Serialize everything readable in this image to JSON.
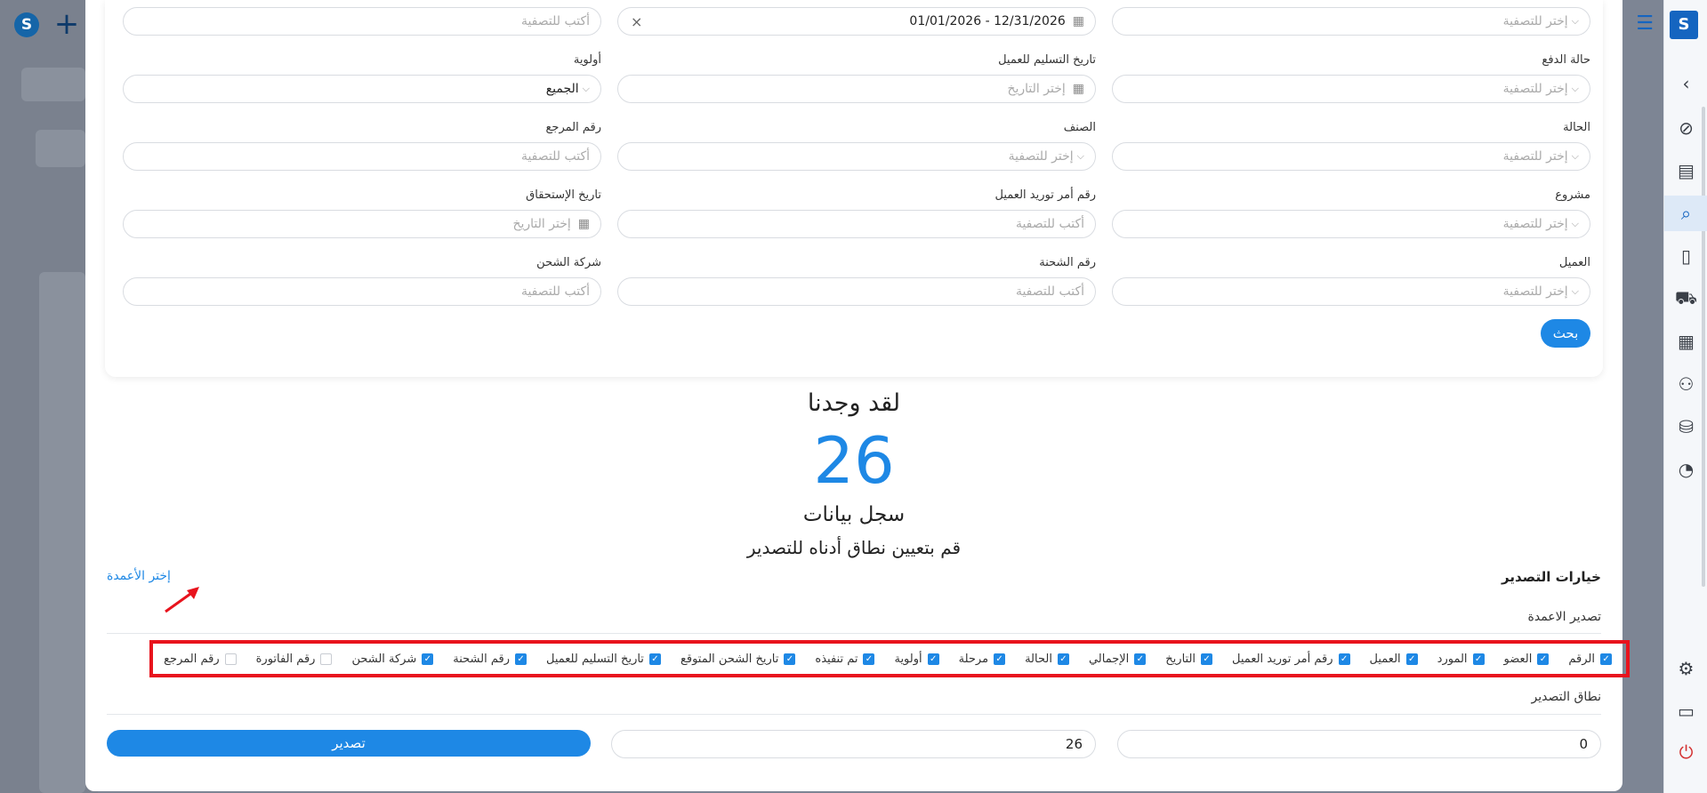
{
  "filters": {
    "row1": {
      "col1": {
        "placeholder": "إختر للتصفية"
      },
      "col2": {
        "value": "01/01/2026 - 12/31/2026"
      },
      "col3": {
        "placeholder": "أكتب للتصفية"
      }
    },
    "row2": {
      "col1": {
        "label": "حالة الدفع",
        "placeholder": "إختر للتصفية"
      },
      "col2": {
        "label": "تاريخ التسليم للعميل",
        "placeholder": "إختر التاريخ"
      },
      "col3": {
        "label": "أولوية",
        "value": "الجميع"
      }
    },
    "row3": {
      "col1": {
        "label": "الحالة",
        "placeholder": "إختر للتصفية"
      },
      "col2": {
        "label": "الصنف",
        "placeholder": "إختر للتصفية"
      },
      "col3": {
        "label": "رقم المرجع",
        "placeholder": "أكتب للتصفية"
      }
    },
    "row4": {
      "col1": {
        "label": "مشروع",
        "placeholder": "إختر للتصفية"
      },
      "col2": {
        "label": "رقم أمر توريد العميل",
        "placeholder": "أكتب للتصفية"
      },
      "col3": {
        "label": "تاريخ الإستحقاق",
        "placeholder": "إختر التاريخ"
      }
    },
    "row5": {
      "col1": {
        "label": "العميل",
        "placeholder": "إختر للتصفية"
      },
      "col2": {
        "label": "رقم الشحنة",
        "placeholder": "أكتب للتصفية"
      },
      "col3": {
        "label": "شركة الشحن",
        "placeholder": "أكتب للتصفية"
      }
    },
    "search_label": "بحث"
  },
  "results": {
    "title": "لقد وجدنا",
    "count": "26",
    "unit": "سجل بيانات",
    "hint": "قم بتعيين نطاق أدناه للتصدير"
  },
  "export": {
    "options_title": "خيارات التصدير",
    "choose_columns": "إختر الأعمدة",
    "columns_label": "تصدير الاعمدة",
    "columns": [
      {
        "label": "الرقم",
        "checked": true
      },
      {
        "label": "العضو",
        "checked": true
      },
      {
        "label": "المورد",
        "checked": true
      },
      {
        "label": "العميل",
        "checked": true
      },
      {
        "label": "رقم أمر توريد العميل",
        "checked": true
      },
      {
        "label": "التاريخ",
        "checked": true
      },
      {
        "label": "الإجمالي",
        "checked": true
      },
      {
        "label": "الحالة",
        "checked": true
      },
      {
        "label": "مرحلة",
        "checked": true
      },
      {
        "label": "أولوية",
        "checked": true
      },
      {
        "label": "تم تنفيذه",
        "checked": true
      },
      {
        "label": "تاريخ الشحن المتوقع",
        "checked": true
      },
      {
        "label": "تاريخ التسليم للعميل",
        "checked": true
      },
      {
        "label": "رقم الشحنة",
        "checked": true
      },
      {
        "label": "شركة الشحن",
        "checked": true
      },
      {
        "label": "رقم الفاتورة",
        "checked": false
      },
      {
        "label": "رقم المرجع",
        "checked": false
      }
    ],
    "range_label": "نطاق التصدير",
    "range_from": "0",
    "range_to": "26",
    "export_label": "تصدير"
  },
  "icons": {
    "sidebar": [
      "chevron-left-icon",
      "compass-icon",
      "store-icon",
      "search-document-icon",
      "invoice-icon",
      "delivery-icon",
      "boxes-icon",
      "users-icon",
      "stock-icon",
      "report-chart-icon"
    ],
    "bottom": [
      "settings-icon",
      "window-icon",
      "power-icon"
    ]
  },
  "colors": {
    "accent": "#1e88e5",
    "highlight": "#e8131d",
    "brand": "#1565c0"
  }
}
